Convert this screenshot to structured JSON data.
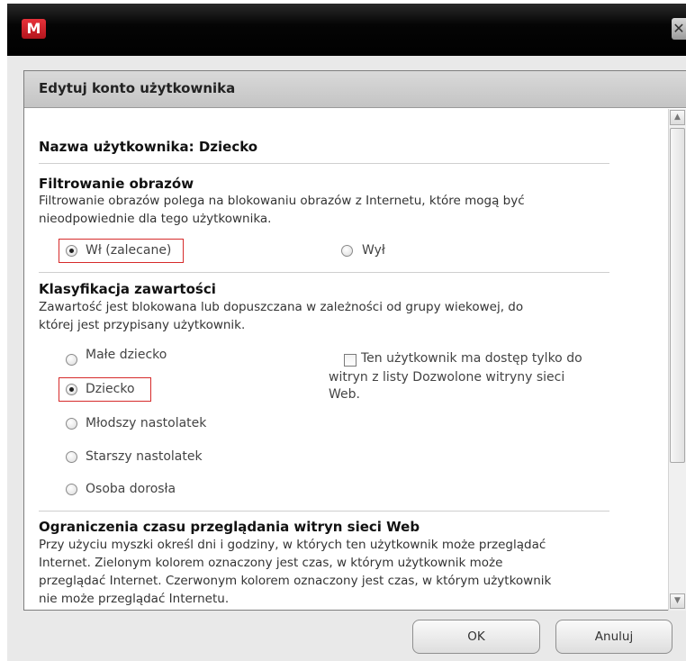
{
  "window": {
    "logo_letter": "M",
    "close_glyph": "✕"
  },
  "panel": {
    "title": "Edytuj konto użytkownika"
  },
  "user": {
    "name_label": "Nazwa użytkownika: Dziecko"
  },
  "image_filtering": {
    "title": "Filtrowanie obrazów",
    "description_line1": "Filtrowanie obrazów polega na blokowaniu obrazów z Internetu, które mogą być",
    "description_line2": "nieodpowiednie dla tego użytkownika.",
    "options": [
      {
        "label": "Wł (zalecane)",
        "selected": true
      },
      {
        "label": "Wył",
        "selected": false
      }
    ]
  },
  "content_rating": {
    "title": "Klasyfikacja zawartości",
    "description_line1": "Zawartość jest blokowana lub dopuszczana w zależności od grupy wiekowej, do",
    "description_line2": "której jest przypisany użytkownik.",
    "options": [
      {
        "label": "Małe dziecko",
        "selected": false
      },
      {
        "label": "Dziecko",
        "selected": true
      },
      {
        "label": "Młodszy nastolatek",
        "selected": false
      },
      {
        "label": "Starszy nastolatek",
        "selected": false
      },
      {
        "label": "Osoba dorosła",
        "selected": false
      }
    ],
    "allowed_sites_checkbox": {
      "line1": "Ten użytkownik ma dostęp tylko do",
      "line2": "witryn z listy Dozwolone witryny sieci",
      "line3": "Web.",
      "checked": false
    }
  },
  "time_limits": {
    "title": "Ograniczenia czasu przeglądania witryn sieci Web",
    "line1": "Przy użyciu myszki określ dni i godziny, w których ten użytkownik może przeglądać",
    "line2": "Internet. Zielonym kolorem oznaczony jest czas, w którym użytkownik może",
    "line3": "przeglądać Internet. Czerwonym kolorem oznaczony jest czas, w którym użytkownik",
    "line4": "nie może przeglądać Internetu."
  },
  "buttons": {
    "ok": "OK",
    "cancel": "Anuluj"
  },
  "colors": {
    "highlight_box": "#d62b2b",
    "titlebar": "#000000",
    "logo": "#d9262e"
  }
}
